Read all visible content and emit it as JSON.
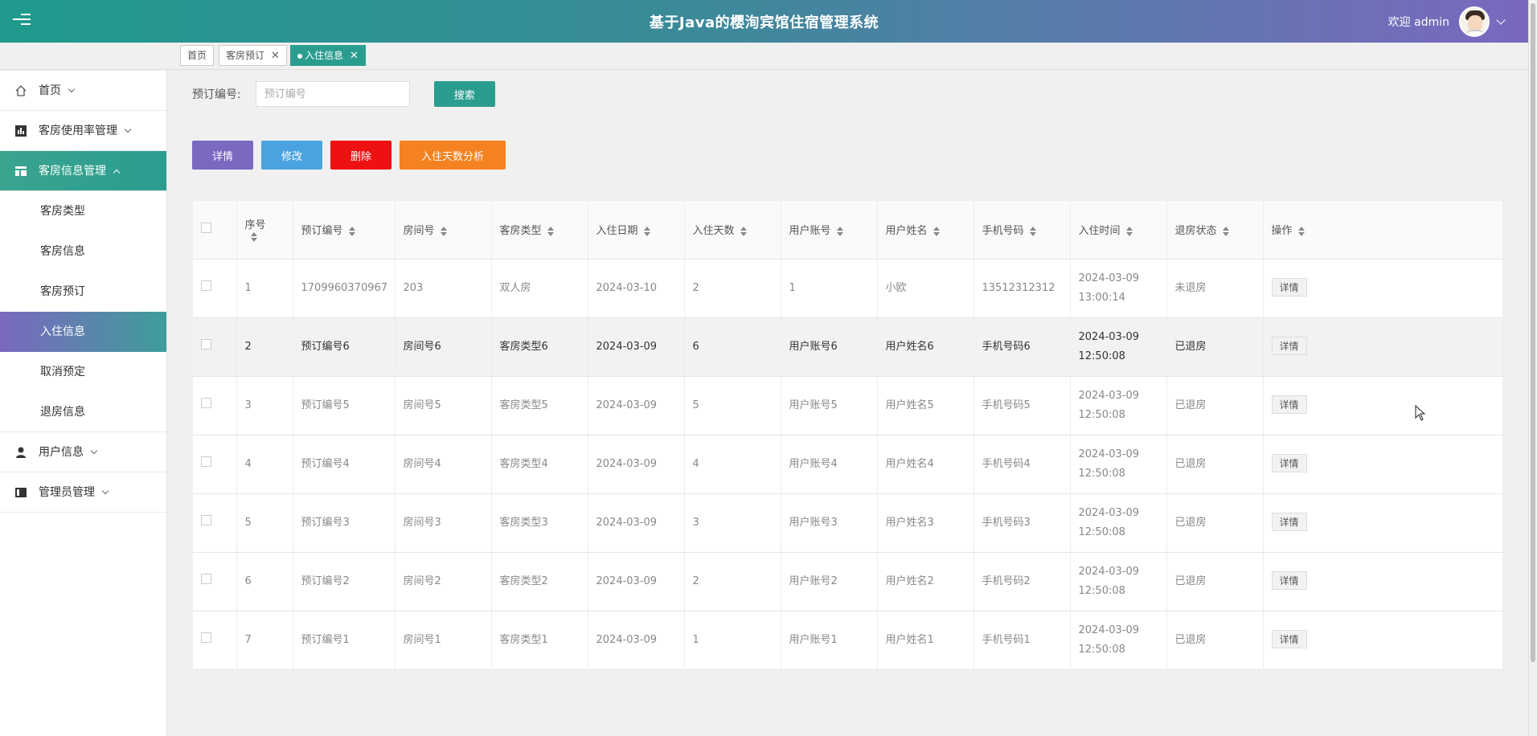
{
  "header": {
    "title": "基于Java的樱洵宾馆住宿管理系统",
    "welcome": "欢迎 admin"
  },
  "tabs": [
    {
      "label": "首页"
    },
    {
      "label": "客房预订"
    },
    {
      "label": "入住信息"
    }
  ],
  "sidebar": {
    "items": [
      {
        "label": "首页",
        "icon": "home-icon"
      },
      {
        "label": "客房使用率管理",
        "icon": "chart-icon"
      },
      {
        "label": "客房信息管理",
        "icon": "layout-icon"
      },
      {
        "label": "用户信息",
        "icon": "user-icon"
      },
      {
        "label": "管理员管理",
        "icon": "admin-icon"
      }
    ],
    "subitems": [
      "客房类型",
      "客房信息",
      "客房预订",
      "入住信息",
      "取消预定",
      "退房信息"
    ]
  },
  "search": {
    "label": "预订编号:",
    "placeholder": "预订编号",
    "button": "搜索"
  },
  "actions": {
    "detail": "详情",
    "edit": "修改",
    "delete": "删除",
    "analyze": "入住天数分析"
  },
  "table": {
    "columns": [
      "序号",
      "预订编号",
      "房间号",
      "客房类型",
      "入住日期",
      "入住天数",
      "用户账号",
      "用户姓名",
      "手机号码",
      "入住时间",
      "退房状态",
      "操作"
    ],
    "row_button": "详情",
    "rows": [
      {
        "no": "1",
        "code": "1709960370967",
        "room": "203",
        "type": "双人房",
        "date": "2024-03-10",
        "days": "2",
        "account": "1",
        "name": "小欧",
        "phone": "13512312312",
        "time": "2024-03-09 13:00:14",
        "status": "未退房"
      },
      {
        "no": "2",
        "code": "预订编号6",
        "room": "房间号6",
        "type": "客房类型6",
        "date": "2024-03-09",
        "days": "6",
        "account": "用户账号6",
        "name": "用户姓名6",
        "phone": "手机号码6",
        "time": "2024-03-09 12:50:08",
        "status": "已退房"
      },
      {
        "no": "3",
        "code": "预订编号5",
        "room": "房间号5",
        "type": "客房类型5",
        "date": "2024-03-09",
        "days": "5",
        "account": "用户账号5",
        "name": "用户姓名5",
        "phone": "手机号码5",
        "time": "2024-03-09 12:50:08",
        "status": "已退房"
      },
      {
        "no": "4",
        "code": "预订编号4",
        "room": "房间号4",
        "type": "客房类型4",
        "date": "2024-03-09",
        "days": "4",
        "account": "用户账号4",
        "name": "用户姓名4",
        "phone": "手机号码4",
        "time": "2024-03-09 12:50:08",
        "status": "已退房"
      },
      {
        "no": "5",
        "code": "预订编号3",
        "room": "房间号3",
        "type": "客房类型3",
        "date": "2024-03-09",
        "days": "3",
        "account": "用户账号3",
        "name": "用户姓名3",
        "phone": "手机号码3",
        "time": "2024-03-09 12:50:08",
        "status": "已退房"
      },
      {
        "no": "6",
        "code": "预订编号2",
        "room": "房间号2",
        "type": "客房类型2",
        "date": "2024-03-09",
        "days": "2",
        "account": "用户账号2",
        "name": "用户姓名2",
        "phone": "手机号码2",
        "time": "2024-03-09 12:50:08",
        "status": "已退房"
      },
      {
        "no": "7",
        "code": "预订编号1",
        "room": "房间号1",
        "type": "客房类型1",
        "date": "2024-03-09",
        "days": "1",
        "account": "用户账号1",
        "name": "用户姓名1",
        "phone": "手机号码1",
        "time": "2024-03-09 12:50:08",
        "status": "已退房"
      }
    ]
  },
  "colors": {
    "primary": "#2a9d8f",
    "purple": "#7b68c0",
    "blue": "#4aa3df",
    "red": "#ee1111",
    "orange": "#f58220"
  }
}
